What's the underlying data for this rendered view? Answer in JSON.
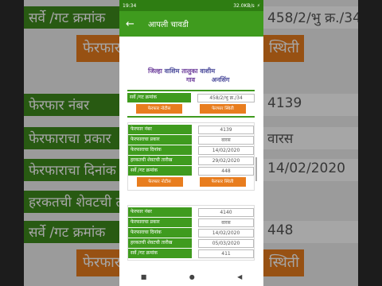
{
  "background": {
    "rows": [
      "सर्वे /गट क्रमांक",
      "फेरफार नंबर",
      "फेरफाराचा प्रकार",
      "फेरफाराचा दिनांक",
      "हरकतची शेवटची तारीख",
      "सर्वे /गट क्रमांक"
    ],
    "values": [
      "458/2/भु क्र./34",
      "4139",
      "वारस",
      "14/02/2020",
      "",
      "448"
    ],
    "buttons": [
      "फेरफार नोटीस",
      "फेरफार स्थिती",
      "फेरफार",
      "स्थिती"
    ]
  },
  "status_bar": {
    "time": "19:34",
    "speed": "32.0KB/s",
    "battery": "⚡"
  },
  "app_bar": {
    "title": "आपली चावडी"
  },
  "location": {
    "district_label": "जिल्हा",
    "district": "वाशिम",
    "taluka_label": "तालुका",
    "taluka": "वाशीम",
    "village_label": "गाव",
    "village": "अनसिंग"
  },
  "survey": {
    "label": "सर्वे /गट क्रमांक",
    "value": "458/2/भु क्र./34",
    "notice_button": "फेरफार नोटीस",
    "status_button": "फेरफार स्थिती"
  },
  "records": [
    {
      "mutation_no_label": "फेरफार नंबर",
      "mutation_no": "4139",
      "type_label": "फेरफाराचा प्रकार",
      "type": "वारस",
      "date_label": "फेरफाराचा दिनांक",
      "date": "14/02/2020",
      "objection_label": "हरकतची शेवटची तारीख",
      "objection": "29/02/2020",
      "survey_label": "सर्वे /गट क्रमांक",
      "survey": "448",
      "notice_button": "फेरफार नोटीस",
      "status_button": "फेरफार स्थिती"
    },
    {
      "mutation_no_label": "फेरफार नंबर",
      "mutation_no": "4140",
      "type_label": "फेरफाराचा प्रकार",
      "type": "वारस",
      "date_label": "फेरफाराचा दिनांक",
      "date": "14/02/2020",
      "objection_label": "हरकतची शेवटची तारीख",
      "objection": "05/03/2020",
      "survey_label": "सर्वे /गट क्रमांक",
      "survey": "411"
    }
  ],
  "nav": {
    "recents": "■",
    "home": "●",
    "back": "◀"
  },
  "colors": {
    "primary": "#3f9b1e",
    "status_bar": "#2e7d12",
    "button": "#e87d1e"
  }
}
